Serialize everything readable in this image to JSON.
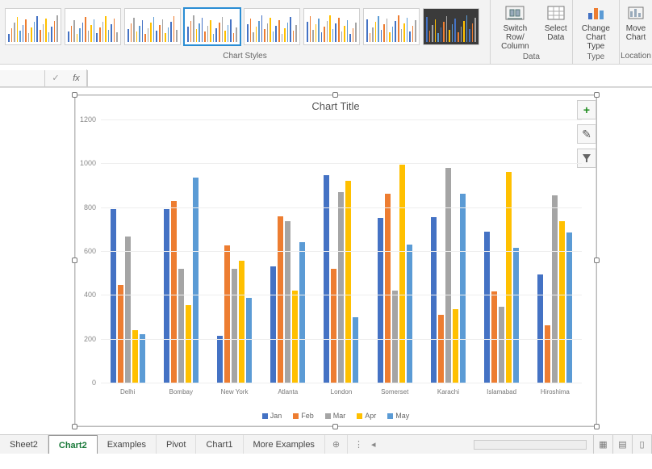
{
  "colors": {
    "jan": "#4472C4",
    "feb": "#ED7D31",
    "mar": "#A5A5A5",
    "apr": "#FFC000",
    "may": "#5B9BD5"
  },
  "ribbon": {
    "styles_label": "Chart Styles",
    "buttons": {
      "switch": "Switch Row/\nColumn",
      "select_data": "Select\nData",
      "change_type": "Change\nChart Type",
      "move_chart": "Move\nChart"
    },
    "group_labels": {
      "data": "Data",
      "type": "Type",
      "location": "Location"
    }
  },
  "formula_bar": {
    "fx": "fx",
    "check": "✓",
    "value": ""
  },
  "chart": {
    "title": "Chart Title",
    "side_buttons": {
      "add": "+",
      "brush": "✎",
      "filter": "▾"
    }
  },
  "chart_data": {
    "type": "bar",
    "title": "Chart Title",
    "xlabel": "",
    "ylabel": "",
    "ylim": [
      0,
      1200
    ],
    "yticks": [
      0,
      200,
      400,
      600,
      800,
      1000,
      1200
    ],
    "categories": [
      "Delhi",
      "Bombay",
      "New York",
      "Atlanta",
      "London",
      "Somerset",
      "Karachi",
      "Islamabad",
      "Hiroshima"
    ],
    "series": [
      {
        "name": "Jan",
        "color_key": "jan",
        "values": [
          790,
          790,
          215,
          530,
          945,
          750,
          755,
          690,
          495
        ]
      },
      {
        "name": "Feb",
        "color_key": "feb",
        "values": [
          445,
          830,
          625,
          760,
          520,
          860,
          310,
          415,
          260
        ]
      },
      {
        "name": "Mar",
        "color_key": "mar",
        "values": [
          665,
          520,
          520,
          735,
          870,
          420,
          980,
          345,
          855
        ]
      },
      {
        "name": "Apr",
        "color_key": "apr",
        "values": [
          240,
          355,
          555,
          420,
          920,
          995,
          335,
          960,
          735
        ]
      },
      {
        "name": "May",
        "color_key": "may",
        "values": [
          220,
          935,
          385,
          640,
          300,
          630,
          860,
          615,
          685
        ]
      }
    ]
  },
  "tabs": {
    "items": [
      "Sheet2",
      "Chart2",
      "Examples",
      "Pivot",
      "Chart1",
      "More Examples"
    ],
    "active": "Chart2",
    "new": "⊕"
  }
}
